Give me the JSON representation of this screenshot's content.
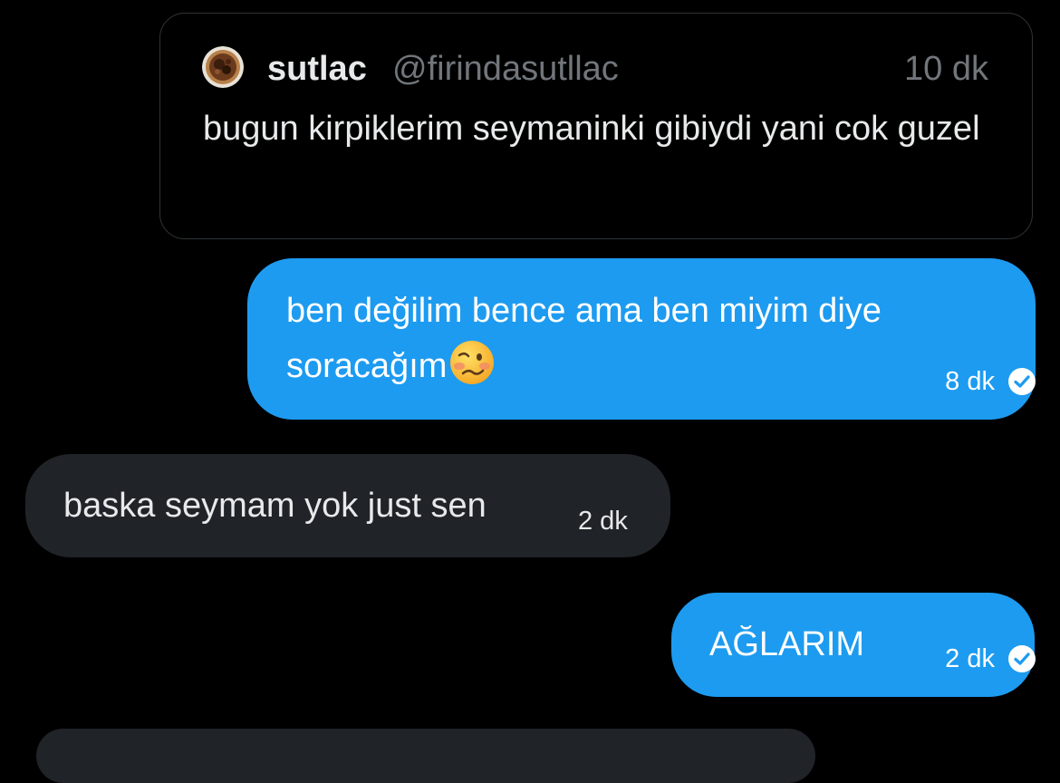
{
  "quoted_post": {
    "display_name": "sutlac",
    "handle": "@firindasutllac",
    "time": "10 dk",
    "text": "bugun kirpiklerim seymaninki gibiydi yani cok guzel",
    "avatar_icon": "rice-pudding-avatar"
  },
  "messages": [
    {
      "direction": "sent",
      "text": "ben değilim bence ama ben miyim diye soracağım",
      "emoji": "woozy-face-icon",
      "time": "8 dk",
      "status_icon": "read-check-icon"
    },
    {
      "direction": "received",
      "text": "baska seymam yok just sen",
      "time": "2 dk"
    },
    {
      "direction": "sent",
      "text": "AĞLARIM",
      "time": "2 dk",
      "status_icon": "read-check-icon"
    }
  ],
  "colors": {
    "background": "#000000",
    "sent_bubble": "#1d9bf0",
    "received_bubble": "#202327",
    "secondary_text": "#71767b",
    "card_border": "#2f3336"
  }
}
